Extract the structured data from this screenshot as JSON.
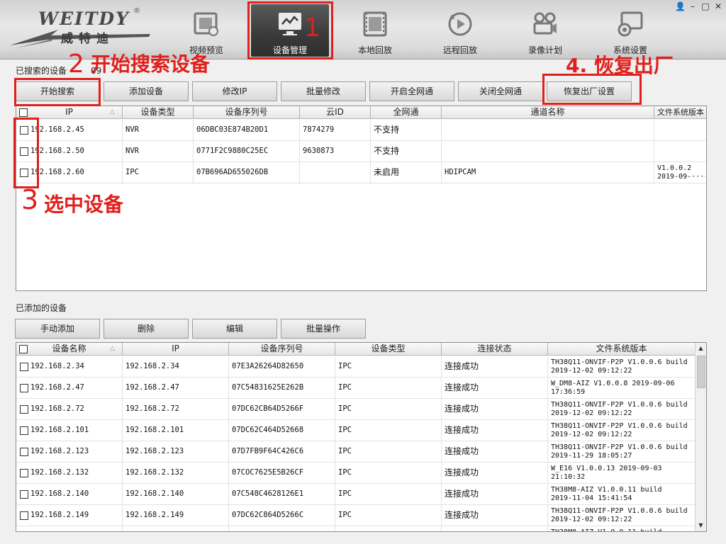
{
  "logo": {
    "brand": "WEITDY",
    "reg": "®",
    "sub": "威特迪"
  },
  "nav": [
    {
      "label": "视频预览",
      "icon": "video-preview-icon"
    },
    {
      "label": "设备管理",
      "icon": "device-management-icon"
    },
    {
      "label": "本地回放",
      "icon": "local-playback-icon"
    },
    {
      "label": "远程回放",
      "icon": "remote-playback-icon"
    },
    {
      "label": "录像计划",
      "icon": "recording-plan-icon"
    },
    {
      "label": "系统设置",
      "icon": "system-settings-icon"
    }
  ],
  "window_controls": {
    "user": "👤",
    "minimize": "–",
    "maximize": "□",
    "close": "✕"
  },
  "annotations": {
    "step1": "1",
    "step2_num": "2",
    "step2_text": "开始搜索设备",
    "step3_num": "3",
    "step3_text": "选中设备",
    "step4": "4. 恢复出厂"
  },
  "searched": {
    "label": "已搜索的设备",
    "count": "09",
    "buttons": [
      "开始搜索",
      "添加设备",
      "修改IP",
      "批量修改",
      "开启全网通",
      "关闭全网通",
      "恢复出厂设置"
    ],
    "columns": [
      "IP",
      "设备类型",
      "设备序列号",
      "云ID",
      "全网通",
      "通道名称",
      "文件系统版本"
    ],
    "rows": [
      {
        "ip": "192.168.2.45",
        "type": "NVR",
        "serial": "06DBC03E874B20D1",
        "cloud": "7874279",
        "net": "不支持",
        "channel": "",
        "fw": ""
      },
      {
        "ip": "192.168.2.50",
        "type": "NVR",
        "serial": "0771F2C9880C25EC",
        "cloud": "9630873",
        "net": "不支持",
        "channel": "",
        "fw": ""
      },
      {
        "ip": "192.168.2.60",
        "type": "IPC",
        "serial": "07B696AD655026DB",
        "cloud": "",
        "net": "未启用",
        "channel": "HDIPCAM",
        "fw": "V1.0.0.2\n2019-09-····"
      }
    ]
  },
  "added": {
    "label": "已添加的设备",
    "buttons": [
      "手动添加",
      "删除",
      "编辑",
      "批量操作"
    ],
    "columns": [
      "设备名称",
      "IP",
      "设备序列号",
      "设备类型",
      "连接状态",
      "文件系统版本"
    ],
    "rows": [
      {
        "name": "192.168.2.34",
        "ip": "192.168.2.34",
        "serial": "07E3A26264D82650",
        "type": "IPC",
        "status": "连接成功",
        "fw": "TH38Q11-ONVIF-P2P V1.0.0.6 build\n2019-12-02 09:12:22"
      },
      {
        "name": "192.168.2.47",
        "ip": "192.168.2.47",
        "serial": "07C54831625E262B",
        "type": "IPC",
        "status": "连接成功",
        "fw": "W_DM8-AIZ V1.0.0.8 2019-09-06\n17:36:59"
      },
      {
        "name": "192.168.2.72",
        "ip": "192.168.2.72",
        "serial": "07DC62CB64D5266F",
        "type": "IPC",
        "status": "连接成功",
        "fw": "TH38Q11-ONVIF-P2P V1.0.0.6 build\n2019-12-02 09:12:22"
      },
      {
        "name": "192.168.2.101",
        "ip": "192.168.2.101",
        "serial": "07DC62C464D52668",
        "type": "IPC",
        "status": "连接成功",
        "fw": "TH38Q11-ONVIF-P2P V1.0.0.6 build\n2019-12-02 09:12:22"
      },
      {
        "name": "192.168.2.123",
        "ip": "192.168.2.123",
        "serial": "07D7FB9F64C426C6",
        "type": "IPC",
        "status": "连接成功",
        "fw": "TH38Q11-ONVIF-P2P V1.0.0.6 build\n2019-11-29 18:05:27"
      },
      {
        "name": "192.168.2.132",
        "ip": "192.168.2.132",
        "serial": "07COC7625E5B26CF",
        "type": "IPC",
        "status": "连接成功",
        "fw": "W_E16 V1.0.0.13 2019-09-03\n21:10:32"
      },
      {
        "name": "192.168.2.140",
        "ip": "192.168.2.140",
        "serial": "07C548C4628126E1",
        "type": "IPC",
        "status": "连接成功",
        "fw": "TH38M8-AIZ V1.0.0.11 build\n2019-11-04 15:41:54"
      },
      {
        "name": "192.168.2.149",
        "ip": "192.168.2.149",
        "serial": "07DC62C864D5266C",
        "type": "IPC",
        "status": "连接成功",
        "fw": "TH38Q11-ONVIF-P2P V1.0.0.6 build\n2019-12-02 09:12:22"
      }
    ],
    "partial_row_fw": "TH38M8-AIZ V1.0.0.11 build"
  },
  "colors": {
    "annotation_red": "#e0201c",
    "active_tab": "#3a3a3a"
  }
}
